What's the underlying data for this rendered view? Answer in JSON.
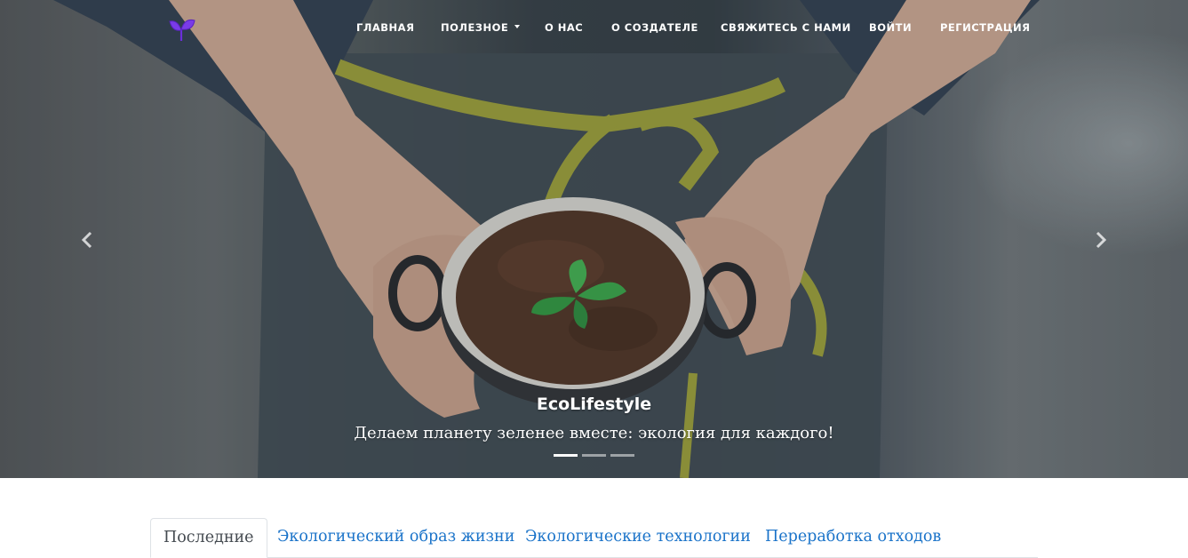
{
  "navbar": {
    "logo_icon": "sprout-icon",
    "logo_color": "#6b2fd9",
    "items": [
      {
        "label": "ГЛАВНАЯ"
      },
      {
        "label": "ПОЛЕЗНОЕ",
        "dropdown": true
      },
      {
        "label": "О НАС"
      },
      {
        "label": "О СОЗДАТЕЛЕ"
      },
      {
        "label": "СВЯЖИТЕСЬ С НАМИ"
      },
      {
        "label": "ВОЙТИ"
      },
      {
        "label": "РЕГИСТРАЦИЯ"
      }
    ]
  },
  "carousel": {
    "title": "EcoLifestyle",
    "subtitle": "Делаем планету зеленее вместе: экология для каждого!",
    "prev_icon": "chevron-left-icon",
    "next_icon": "chevron-right-icon",
    "slide_count": 3,
    "active_slide": 1
  },
  "tabs": [
    {
      "label": "Последние",
      "active": true
    },
    {
      "label": "Экологический образ жизни"
    },
    {
      "label": "Экологические технологии"
    },
    {
      "label": "Переработка отходов"
    }
  ],
  "colors": {
    "link": "#1a73c9",
    "active_tab_text": "#444a50",
    "nav_text": "#ffffff"
  }
}
